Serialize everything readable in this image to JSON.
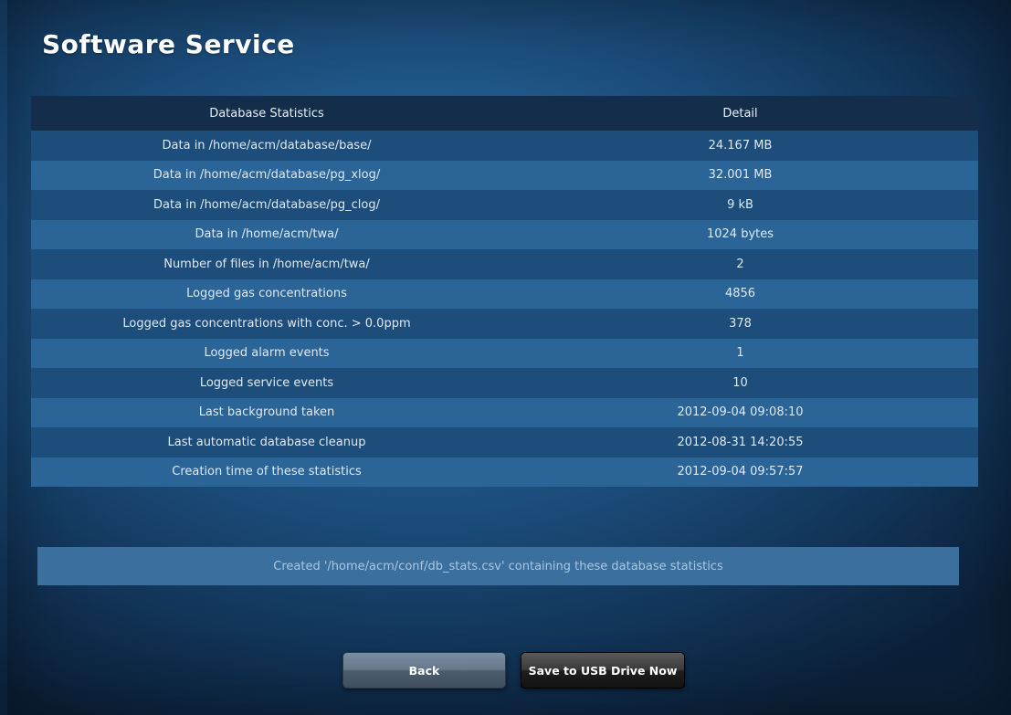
{
  "page": {
    "title": "Software Service"
  },
  "table": {
    "headers": [
      "Database Statistics",
      "Detail"
    ],
    "rows": [
      {
        "label": "Data in /home/acm/database/base/",
        "value": "24.167 MB"
      },
      {
        "label": "Data in /home/acm/database/pg_xlog/",
        "value": "32.001 MB"
      },
      {
        "label": "Data in /home/acm/database/pg_clog/",
        "value": "9 kB"
      },
      {
        "label": "Data in /home/acm/twa/",
        "value": "1024 bytes"
      },
      {
        "label": "Number of files in /home/acm/twa/",
        "value": "2"
      },
      {
        "label": "Logged gas concentrations",
        "value": "4856"
      },
      {
        "label": "Logged gas concentrations with conc. > 0.0ppm",
        "value": "378"
      },
      {
        "label": "Logged alarm events",
        "value": "1"
      },
      {
        "label": "Logged service events",
        "value": "10"
      },
      {
        "label": "Last background taken",
        "value": "2012-09-04 09:08:10"
      },
      {
        "label": "Last automatic database cleanup",
        "value": "2012-08-31 14:20:55"
      },
      {
        "label": "Creation time of these statistics",
        "value": "2012-09-04 09:57:57"
      }
    ]
  },
  "status": {
    "message": "Created '/home/acm/conf/db_stats.csv' containing these database statistics"
  },
  "buttons": {
    "back_label": "Back",
    "save_label": "Save to USB Drive Now"
  },
  "colors": {
    "background": "#21588a",
    "header_row": "#132d4b",
    "row_dark": "#1d4d7a",
    "row_light": "#2b6497",
    "message_bar": "#3b6f9e"
  }
}
